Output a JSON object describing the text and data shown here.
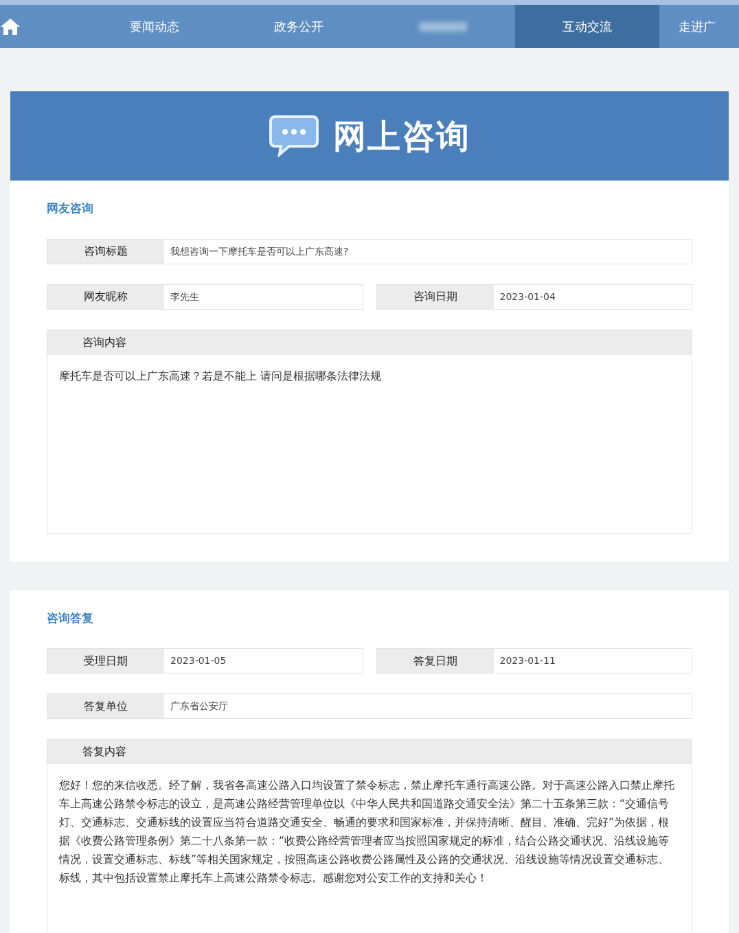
{
  "nav": {
    "items": [
      {
        "label": "要闻动态",
        "selected": false
      },
      {
        "label": "政务公开",
        "selected": false
      },
      {
        "kind": "blurred",
        "selected": false
      },
      {
        "label": "互动交流",
        "selected": true
      },
      {
        "label": "走进广",
        "selected": false
      }
    ]
  },
  "banner": {
    "title": "网上咨询"
  },
  "consultation": {
    "heading": "网友咨询",
    "rows": [
      [
        {
          "label": "咨询标题",
          "value": "我想咨询一下摩托车是否可以上广东高速?"
        }
      ],
      [
        {
          "label": "网友昵称",
          "value": "李先生"
        },
        {
          "label": "咨询日期",
          "value": "2023-01-04"
        }
      ]
    ],
    "content": {
      "label": "咨询内容",
      "text": "摩托车是否可以上广东高速？若是不能上 请问是根据哪条法律法规"
    }
  },
  "reply": {
    "heading": "咨询答复",
    "rows": [
      [
        {
          "label": "受理日期",
          "value": "2023-01-05"
        },
        {
          "label": "答复日期",
          "value": "2023-01-11"
        }
      ],
      [
        {
          "label": "答复单位",
          "value": "广东省公安厅"
        }
      ]
    ],
    "content": {
      "label": "答复内容",
      "text": "您好！您的来信收悉。经了解，我省各高速公路入口均设置了禁令标志，禁止摩托车通行高速公路。对于高速公路入口禁止摩托车上高速公路禁令标志的设立，是高速公路经营管理单位以《中华人民共和国道路交通安全法》第二十五条第三款：“交通信号灯、交通标志、交通标线的设置应当符合道路交通安全、畅通的要求和国家标准，并保持清晰、醒目、准确、完好”为依据，根据《收费公路管理条例》第二十八条第一款：“收费公路经营管理者应当按照国家规定的标准，结合公路交通状况、沿线设施等情况，设置交通标志、标线”等相关国家规定，按照高速公路收费公路属性及公路的交通状况、沿线设施等情况设置交通标志、标线，其中包括设置禁止摩托车上高速公路禁令标志。感谢您对公安工作的支持和关心！"
    }
  }
}
